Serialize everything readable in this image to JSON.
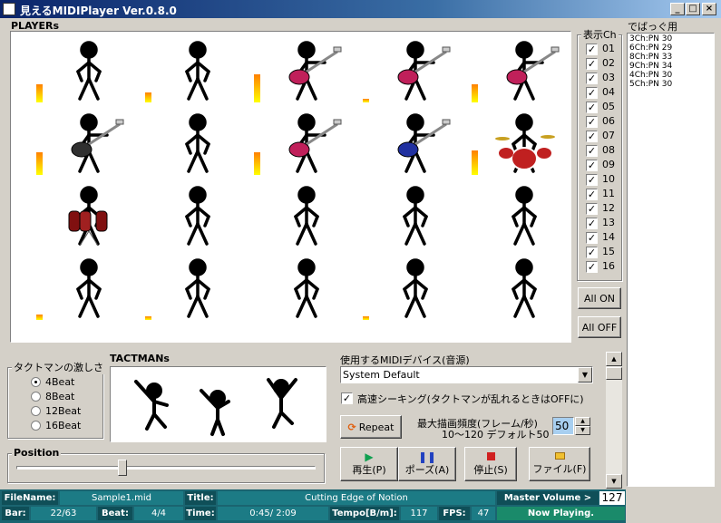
{
  "window": {
    "title": "見えるMIDIPlayer  Ver.0.8.0",
    "minimize": "_",
    "maximize": "□",
    "close": "×"
  },
  "players": {
    "title": "PLAYERs",
    "rows": [
      [
        {
          "figure": "stand",
          "meter": 0.55
        },
        {
          "figure": "stand",
          "meter": 0.3
        },
        {
          "figure": "guitar",
          "meter": 0.85
        },
        {
          "figure": "guitar",
          "meter": 0.1
        },
        {
          "figure": "guitar",
          "meter": 0.55
        }
      ],
      [
        {
          "figure": "bass",
          "meter": 0.7
        },
        {
          "figure": "stand",
          "meter": 0
        },
        {
          "figure": "guitar",
          "meter": 0.7
        },
        {
          "figure": "bass-blue",
          "meter": 0
        },
        {
          "figure": "drums",
          "meter": 0.75
        }
      ],
      [
        {
          "figure": "conga",
          "meter": 0
        },
        {
          "figure": "stand",
          "meter": 0
        },
        {
          "figure": "stand",
          "meter": 0
        },
        {
          "figure": "stand",
          "meter": 0
        },
        {
          "figure": "stand",
          "meter": 0
        }
      ],
      [
        {
          "figure": "stand",
          "meter": 0.18
        },
        {
          "figure": "stand",
          "meter": 0.1
        },
        {
          "figure": "stand",
          "meter": 0
        },
        {
          "figure": "stand",
          "meter": 0.1
        },
        {
          "figure": "stand",
          "meter": 0
        }
      ]
    ]
  },
  "channels": {
    "title": "表示Ch",
    "items": [
      {
        "label": "01",
        "checked": true
      },
      {
        "label": "02",
        "checked": true
      },
      {
        "label": "03",
        "checked": true
      },
      {
        "label": "04",
        "checked": true
      },
      {
        "label": "05",
        "checked": true
      },
      {
        "label": "06",
        "checked": true
      },
      {
        "label": "07",
        "checked": true
      },
      {
        "label": "08",
        "checked": true
      },
      {
        "label": "09",
        "checked": true
      },
      {
        "label": "10",
        "checked": true
      },
      {
        "label": "11",
        "checked": true
      },
      {
        "label": "12",
        "checked": true
      },
      {
        "label": "13",
        "checked": true
      },
      {
        "label": "14",
        "checked": true
      },
      {
        "label": "15",
        "checked": true
      },
      {
        "label": "16",
        "checked": true
      }
    ],
    "all_on": "All ON",
    "all_off": "All OFF"
  },
  "debug": {
    "title": "でばっぐ用",
    "lines": [
      "3Ch:PN 30",
      "6Ch:PN 29",
      "8Ch:PN 33",
      "9Ch:PN 34",
      "4Ch:PN 30",
      "5Ch:PN 30"
    ]
  },
  "tactman_intensity": {
    "title": "タクトマンの激しさ",
    "options": [
      {
        "label": "4Beat",
        "selected": true
      },
      {
        "label": "8Beat",
        "selected": false
      },
      {
        "label": "12Beat",
        "selected": false
      },
      {
        "label": "16Beat",
        "selected": false
      }
    ]
  },
  "tactmans": {
    "title": "TACTMANs"
  },
  "position": {
    "title": "Position",
    "value": 0.35
  },
  "midi": {
    "device_label": "使用するMIDIデバイス(音源)",
    "device_value": "System Default",
    "fast_seek_label": "高速シーキング(タクトマンが乱れるときはOFFに)",
    "fast_seek_checked": true,
    "repeat_label": "Repeat",
    "fps_label_1": "最大描画頻度(フレーム/秒)",
    "fps_label_2": "10〜120  デフォルト50",
    "fps_value": "50"
  },
  "transport": {
    "play": "再生(P)",
    "pause": "ポーズ(A)",
    "stop": "停止(S)",
    "file": "ファイル(F)"
  },
  "status": {
    "filename_label": "FileName:",
    "filename": "Sample1.mid",
    "title_label": "Title:",
    "title": "Cutting Edge of Notion",
    "master_volume_label": "Master Volume >",
    "master_volume": "127",
    "bar_label": "Bar:",
    "bar": "22/63",
    "beat_label": "Beat:",
    "beat": "4/4",
    "time_label": "Time:",
    "time": "0:45/ 2:09",
    "tempo_label": "Tempo[B/m]:",
    "tempo": "117",
    "fps_label": "FPS:",
    "fps": "47",
    "state": "Now Playing."
  },
  "colors": {
    "title_start": "#0a246a",
    "status_bg": "#1c7b85",
    "status_label_bg": "#0f4f58",
    "meter_top": "#ff8000",
    "meter_bottom": "#ffff00",
    "guitar_body": "#c0205a",
    "bass_body": "#303030",
    "bass_blue_body": "#2030a0"
  }
}
